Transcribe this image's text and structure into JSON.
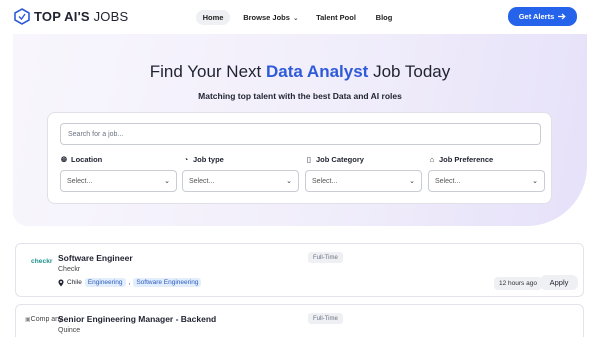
{
  "brand": {
    "name_bold": "TOP AI'S",
    "name_thin": "JOBS"
  },
  "nav": {
    "items": [
      {
        "label": "Home"
      },
      {
        "label": "Browse Jobs"
      },
      {
        "label": "Talent Pool"
      },
      {
        "label": "Blog"
      }
    ],
    "cta": "Get Alerts"
  },
  "hero": {
    "title_pre": "Find Your Next ",
    "title_highlight": "Data Analyst",
    "title_post": " Job Today",
    "subtitle": "Matching top talent with the best Data and AI roles"
  },
  "search": {
    "placeholder": "Search for a job...",
    "filters": [
      {
        "label": "Location",
        "icon": "globe-icon",
        "value": "Select..."
      },
      {
        "label": "Job type",
        "icon": "people-icon",
        "value": "Select..."
      },
      {
        "label": "Job Category",
        "icon": "device-icon",
        "value": "Select..."
      },
      {
        "label": "Job Preference",
        "icon": "home-icon",
        "value": "Select..."
      }
    ]
  },
  "jobs": [
    {
      "title": "Software Engineer",
      "company": "Checkr",
      "logo_text": "checkr",
      "type": "Full-Time",
      "location": "Chile",
      "tags": [
        "Engineering",
        "Software Engineering"
      ],
      "posted": "12 hours ago",
      "apply": "Apply"
    },
    {
      "title": "Senior Engineering Manager - Backend",
      "company": "Quince",
      "logo_alt": "Comp any",
      "type": "Full-Time"
    }
  ],
  "colors": {
    "accent": "#2563eb",
    "highlight": "#2f5bd8"
  }
}
